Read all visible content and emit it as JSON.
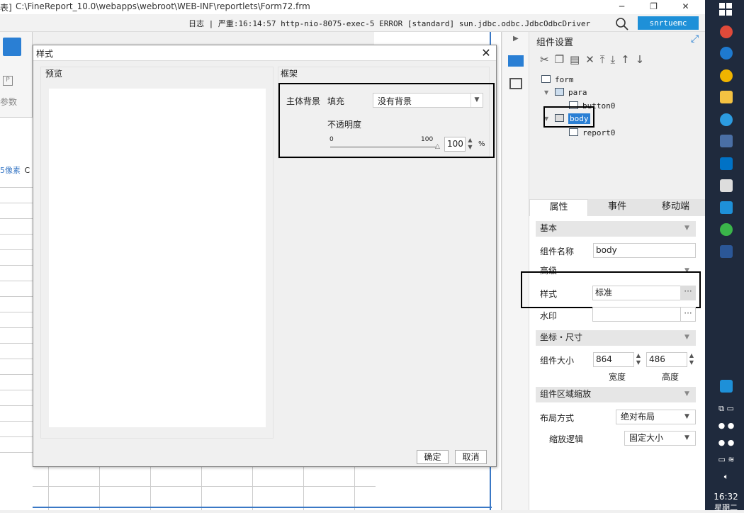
{
  "window": {
    "title": "C:\\FineReport_10.0\\webapps\\webroot\\WEB-INF\\reportlets\\Form72.frm",
    "title_prefix": "表]",
    "min": "─",
    "max": "❐",
    "close": "✕"
  },
  "infobar": {
    "log": "日志 | 严重:16:14:57 http-nio-8075-exec-5 ERROR [standard] sun.jdbc.odbc.JdbcOdbcDriver",
    "user": "snrtuemc"
  },
  "left": {
    "param_label": "参数",
    "ruler_text": "5像素",
    "ruler_col": "C"
  },
  "dialog": {
    "title": "样式",
    "preview_label": "预览",
    "frame_label": "框架",
    "main_bg_label": "主体背景",
    "fill_label": "填充",
    "fill_value": "没有背景",
    "opacity_label": "不透明度",
    "slider_min": "0",
    "slider_max": "100",
    "opacity_value": "100",
    "percent": "%",
    "ok": "确定",
    "cancel": "取消"
  },
  "component_panel": {
    "title": "组件设置",
    "tree": {
      "form": "form",
      "para": "para",
      "button0": "button0",
      "body": "body",
      "report0": "report0"
    },
    "tabs": [
      "属性",
      "事件",
      "移动端"
    ],
    "sections": {
      "basic": "基本",
      "advanced": "高级",
      "coords": "坐标・尺寸",
      "scale": "组件区域缩放"
    },
    "props": {
      "name_label": "组件名称",
      "name_value": "body",
      "style_label": "样式",
      "style_value": "标准",
      "watermark_label": "水印",
      "watermark_value": "",
      "size_label": "组件大小",
      "width_value": "864",
      "height_value": "486",
      "width_label": "宽度",
      "height_label": "高度",
      "layout_label": "布局方式",
      "layout_value": "绝对布局",
      "scale_label": "缩放逻辑",
      "scale_value": "固定大小"
    }
  },
  "taskbar": {
    "time": "16:32",
    "date": "星期二"
  },
  "colors": {
    "accent": "#1e90d8",
    "taskbar": "#1f2a3d"
  }
}
